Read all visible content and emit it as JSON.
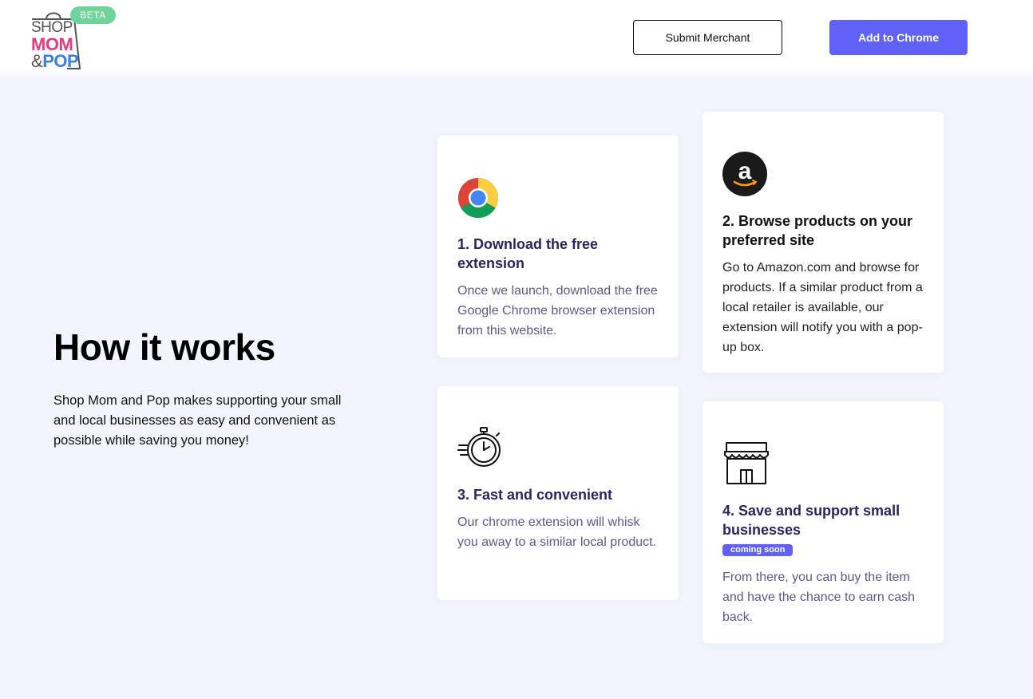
{
  "header": {
    "logo": {
      "shop": "SHOP",
      "mom": "MOM",
      "amp": "&",
      "pop": "POP",
      "beta": "BETA"
    },
    "submit_merchant_label": "Submit Merchant",
    "add_to_chrome_label": "Add to Chrome"
  },
  "intro": {
    "title": "How it works",
    "description": "Shop Mom and Pop makes supporting your small and local businesses as easy and convenient as possible while saving you money!"
  },
  "steps": [
    {
      "icon": "chrome-icon",
      "title": "1. Download the free extension",
      "text": "Once we launch, download the free Google Chrome browser extension from this website."
    },
    {
      "icon": "amazon-icon",
      "title": "2. Browse products on your preferred site",
      "text": "Go to Amazon.com and browse for products. If a similar product from a local retailer is available, our extension will notify you with a pop-up box."
    },
    {
      "icon": "stopwatch-icon",
      "title": "3. Fast and convenient",
      "text": "Our chrome extension will whisk you away to a similar local product."
    },
    {
      "icon": "storefront-icon",
      "title": "4. Save and support small businesses",
      "badge": "coming soon",
      "text": "From there, you can buy the item and have the chance to earn cash back."
    }
  ],
  "colors": {
    "accent": "#6061f7",
    "beta_badge": "#6fd49a",
    "logo_mom": "#e23d83",
    "logo_pop": "#3d7fe0",
    "page_background": "#f3f5fd",
    "card_title": "#2c2461",
    "card_text": "#5b5a8b"
  }
}
